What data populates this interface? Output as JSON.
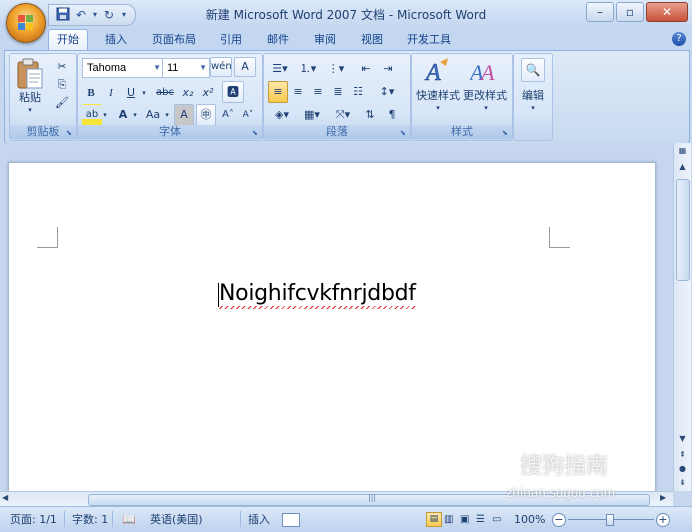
{
  "window": {
    "title": "新建 Microsoft Word 2007 文档 - Microsoft Word",
    "minimize": "–",
    "restore": "▫",
    "close": "✕"
  },
  "qat": {
    "save": "💾",
    "undo": "↶",
    "redo": "↻",
    "customize": "▾"
  },
  "tabs": [
    {
      "label": "开始",
      "active": true
    },
    {
      "label": "插入"
    },
    {
      "label": "页面布局"
    },
    {
      "label": "引用"
    },
    {
      "label": "邮件"
    },
    {
      "label": "审阅"
    },
    {
      "label": "视图"
    },
    {
      "label": "开发工具"
    }
  ],
  "help": "?",
  "ribbon": {
    "clipboard": {
      "label": "剪贴板",
      "paste": "粘贴"
    },
    "font": {
      "label": "字体",
      "font_name": "Tahoma",
      "font_size": "11",
      "bold": "B",
      "italic": "I",
      "underline": "U",
      "strike": "abc",
      "subscript": "x₂",
      "superscript": "x²",
      "change_case": "Aa",
      "char_shading": "A",
      "grow": "A˄",
      "shrink": "A˅",
      "font_color": "A",
      "highlight": "ab"
    },
    "paragraph": {
      "label": "段落"
    },
    "styles": {
      "label": "样式",
      "quick_styles": "快速样式",
      "change_styles": "更改样式"
    },
    "editing": {
      "label": "编辑"
    }
  },
  "document": {
    "text": "Noighifcvkfnrjdbdf"
  },
  "status": {
    "page": "页面: 1/1",
    "words": "字数: 1",
    "language": "英语(美国)",
    "mode": "插入",
    "zoom": "100%"
  },
  "watermark": {
    "brand": "搜狗指南",
    "url": "zhinan.sogou.com"
  },
  "colors": {
    "accent": "#15428b",
    "highlight": "#f7e53b",
    "font_color": "#d80000"
  }
}
